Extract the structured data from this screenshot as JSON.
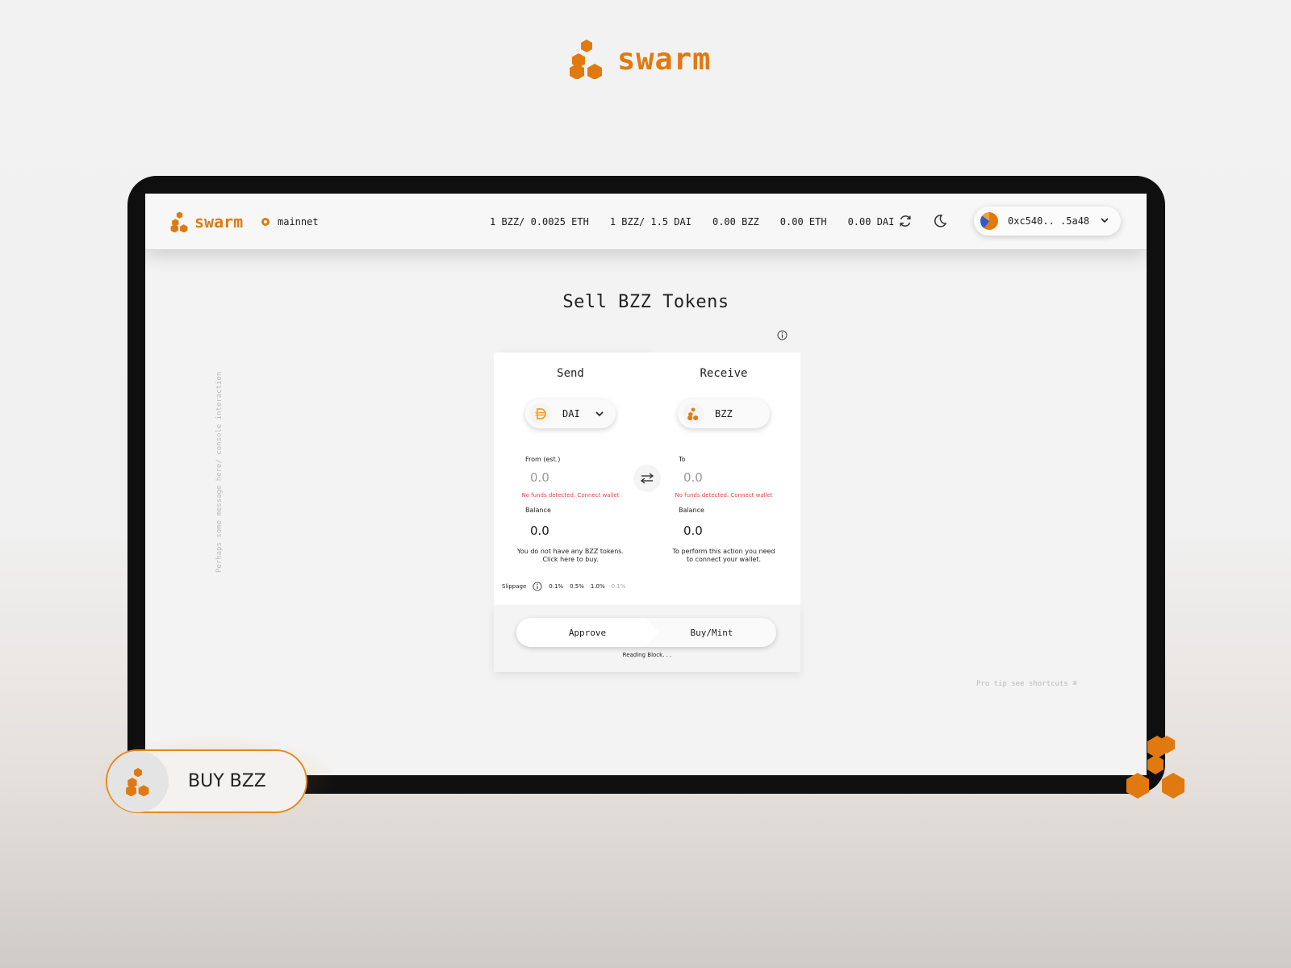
{
  "brand": {
    "wordmark": "swarm"
  },
  "header": {
    "wordmark": "swarm",
    "network": "mainnet",
    "stats": [
      "1 BZZ/ 0.0025 ETH",
      "1 BZZ/ 1.5 DAI",
      "0.00 BZZ",
      "0.00 ETH",
      "0.00 DAI"
    ],
    "wallet_address": "0xc540.. .5a48"
  },
  "side_message": "Perhaps some message here/ console interaction",
  "page_title": "Sell BZZ Tokens",
  "swap": {
    "send": {
      "title": "Send",
      "token": "DAI",
      "from_label": "From (est.)",
      "amount_placeholder": "0.0",
      "error": "No funds detected. Connect wallet",
      "balance_label": "Balance",
      "balance": "0.0",
      "note_line1": "You do not have any BZZ tokens.",
      "note_line2": "Click here to buy."
    },
    "receive": {
      "title": "Receive",
      "token": "BZZ",
      "to_label": "To",
      "amount_placeholder": "0.0",
      "error": "No funds detected. Connect wallet",
      "balance_label": "Balance",
      "balance": "0.0",
      "note_line1": "To perform this action you need",
      "note_line2": "to connect your wallet."
    },
    "slippage": {
      "label": "Slippage",
      "options": [
        "0.1%",
        "0.5%",
        "1.0%"
      ],
      "custom": "0.1%"
    },
    "approve_label": "Approve",
    "buy_label": "Buy/Mint",
    "status": "Reading Block. . ."
  },
  "pro_tip": "Pro tip see shortcuts ⌘",
  "buy_cta": "BUY BZZ",
  "colors": {
    "accent": "#e07a10",
    "error": "#e84444",
    "frame": "#0f0f0f"
  },
  "icons": [
    "swarm-logo-icon",
    "refresh-icon",
    "moon-icon",
    "chevron-down-icon",
    "dai-icon",
    "bzz-icon",
    "swap-arrows-icon",
    "info-icon"
  ]
}
